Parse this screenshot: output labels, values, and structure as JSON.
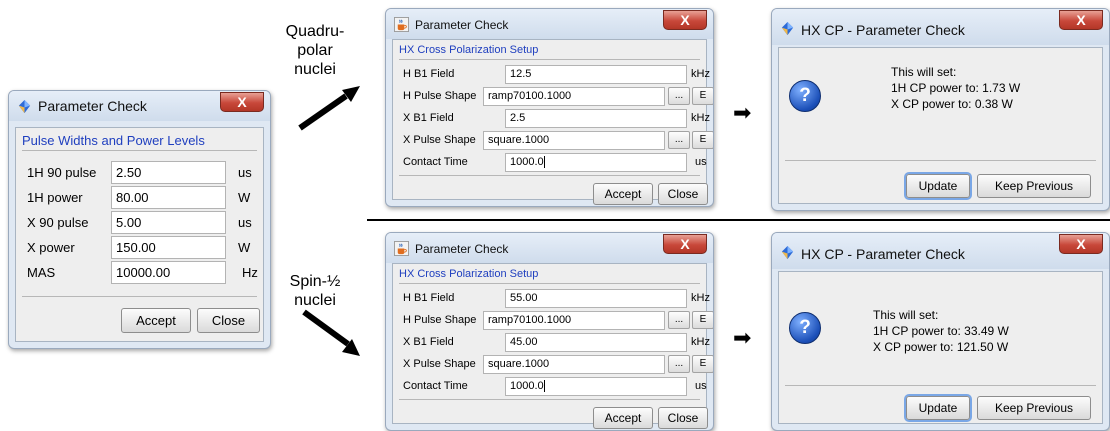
{
  "left_dialog": {
    "title": "Parameter Check",
    "close_label": "X",
    "section": "Pulse Widths and Power Levels",
    "rows": [
      {
        "label": "1H 90 pulse",
        "value": "2.50",
        "unit": "us"
      },
      {
        "label": "1H power",
        "value": "80.00",
        "unit": "W"
      },
      {
        "label": "X 90 pulse",
        "value": "5.00",
        "unit": "us"
      },
      {
        "label": "X power",
        "value": "150.00",
        "unit": "W"
      },
      {
        "label": "MAS",
        "value": "10000.00",
        "unit": "Hz"
      }
    ],
    "accept": "Accept",
    "close": "Close"
  },
  "annotations": {
    "quad_line1": "Quadru-",
    "quad_line2": "polar",
    "quad_line3": "nuclei",
    "spin_line1": "Spin-½",
    "spin_line2": "nuclei"
  },
  "top_setup": {
    "title": "Parameter Check",
    "close_label": "X",
    "section": "HX Cross Polarization Setup",
    "h_b1_label": "H B1 Field",
    "h_b1_value": "12.5",
    "h_b1_unit": "kHz",
    "h_shape_label": "H Pulse Shape",
    "h_shape_value": "ramp70100.1000",
    "x_b1_label": "X B1 Field",
    "x_b1_value": "2.5",
    "x_b1_unit": "kHz",
    "x_shape_label": "X Pulse Shape",
    "x_shape_value": "square.1000",
    "contact_label": "Contact Time",
    "contact_value": "1000.0",
    "contact_unit": "us",
    "dots": "...",
    "e": "E",
    "accept": "Accept",
    "close": "Close"
  },
  "bottom_setup": {
    "title": "Parameter Check",
    "close_label": "X",
    "section": "HX Cross Polarization Setup",
    "h_b1_label": "H B1 Field",
    "h_b1_value": "55.00",
    "h_b1_unit": "kHz",
    "h_shape_label": "H Pulse Shape",
    "h_shape_value": "ramp70100.1000",
    "x_b1_label": "X B1 Field",
    "x_b1_value": "45.00",
    "x_b1_unit": "kHz",
    "x_shape_label": "X Pulse Shape",
    "x_shape_value": "square.1000",
    "contact_label": "Contact Time",
    "contact_value": "1000.0",
    "contact_unit": "us",
    "dots": "...",
    "e": "E",
    "accept": "Accept",
    "close": "Close"
  },
  "top_confirm": {
    "title": "HX CP - Parameter Check",
    "close_label": "X",
    "line1": "This will set:",
    "line2": "1H CP power to: 1.73 W",
    "line3": "X CP power to: 0.38 W",
    "update": "Update",
    "keep": "Keep Previous"
  },
  "bottom_confirm": {
    "title": "HX CP - Parameter Check",
    "close_label": "X",
    "line1": "This will set:",
    "line2": "1H CP power to: 33.49 W",
    "line3": "X CP power to: 121.50 W",
    "update": "Update",
    "keep": "Keep Previous"
  },
  "colors": {
    "section_title": "#1f3fbf",
    "close_button": "#c8483a",
    "title_bar": "#dfe8f3",
    "help_icon": "#1b4fb8"
  },
  "icons": {
    "java_cup": "java-cup-icon",
    "app_diamond": "app-diamond-icon",
    "question": "question-icon",
    "arrow": "arrow-icon"
  }
}
